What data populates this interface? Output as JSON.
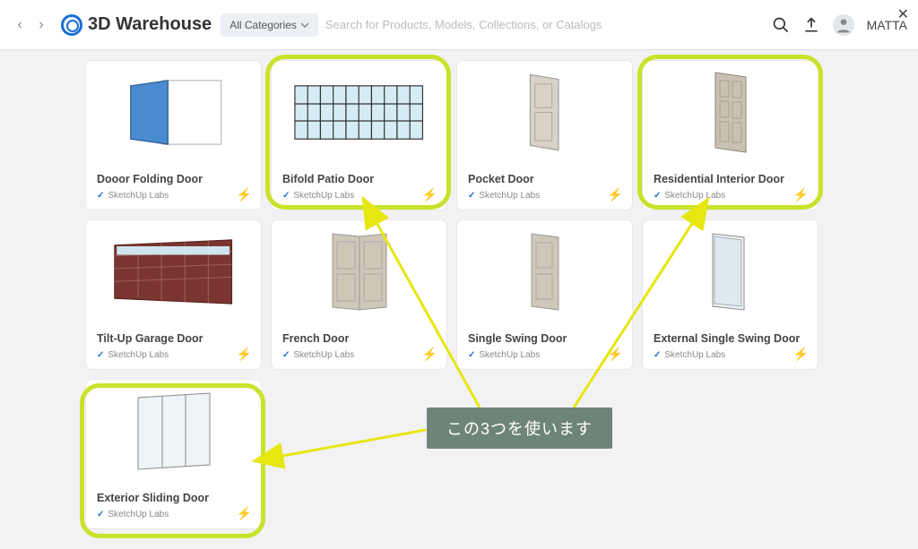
{
  "header": {
    "logo_text": "3D Warehouse",
    "categories_label": "All Categories",
    "search_placeholder": "Search for Products, Models, Collections, or Catalogs",
    "username": "MATTA"
  },
  "annotation_text": "この3つを使います",
  "cards": [
    {
      "title": "Dooor Folding Door",
      "source": "SketchUp Labs"
    },
    {
      "title": "Bifold Patio Door",
      "source": "SketchUp Labs"
    },
    {
      "title": "Pocket Door",
      "source": "SketchUp Labs"
    },
    {
      "title": "Residential Interior Door",
      "source": "SketchUp Labs"
    },
    {
      "title": "Tilt-Up Garage Door",
      "source": "SketchUp Labs"
    },
    {
      "title": "French Door",
      "source": "SketchUp Labs"
    },
    {
      "title": "Single Swing Door",
      "source": "SketchUp Labs"
    },
    {
      "title": "External Single Swing Door",
      "source": "SketchUp Labs"
    },
    {
      "title": "Exterior Sliding Door",
      "source": "SketchUp Labs"
    }
  ]
}
